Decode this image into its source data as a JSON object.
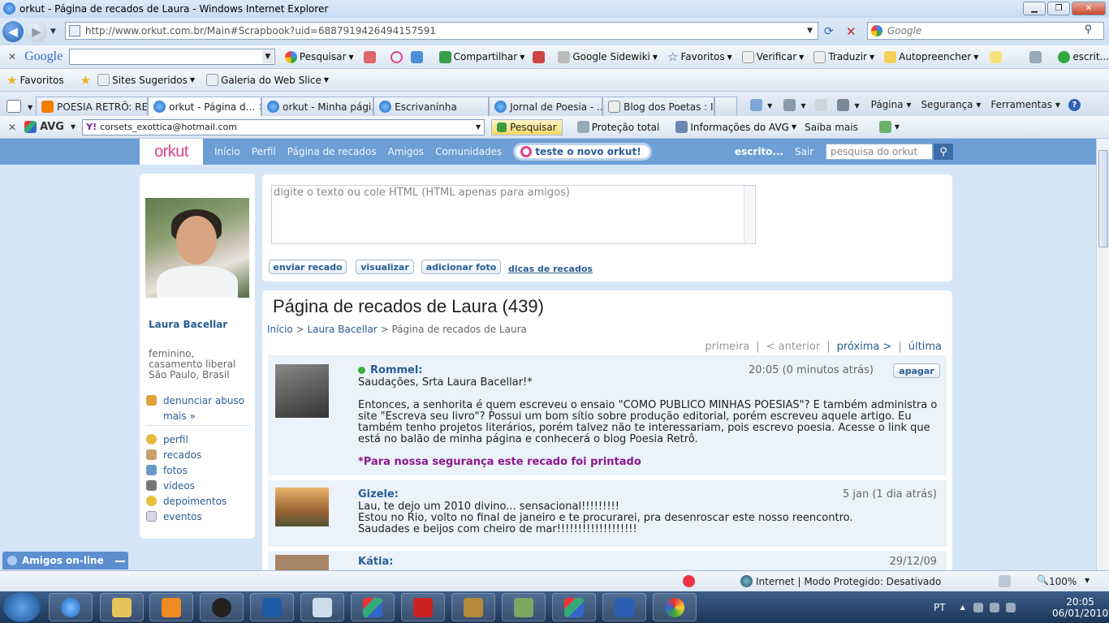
{
  "window": {
    "title": "orkut - Página de recados de Laura - Windows Internet Explorer"
  },
  "address": {
    "url": "http://www.orkut.com.br/Main#Scrapbook?uid=6887919426494157591",
    "search_placeholder": "Google"
  },
  "google_toolbar": {
    "brand": "Google",
    "items": [
      "Pesquisar",
      "Compartilhar",
      "Google Sidewiki",
      "Favoritos",
      "Verificar",
      "Traduzir",
      "Autopreencher",
      "escrit..."
    ]
  },
  "favorites_bar": {
    "favorites": "Favoritos",
    "items": [
      "Sites Sugeridos",
      "Galeria do Web Slice"
    ]
  },
  "tabs": [
    {
      "label": "POESIA RETRÔ: RE...",
      "active": false
    },
    {
      "label": "orkut - Página d...",
      "active": true
    },
    {
      "label": "orkut - Minha pági...",
      "active": false
    },
    {
      "label": "Escrivaninha",
      "active": false
    },
    {
      "label": "Jornal de Poesia - ...",
      "active": false
    },
    {
      "label": "Blog dos Poetas : I...",
      "active": false
    }
  ],
  "command_bar": {
    "pagina": "Página",
    "seguranca": "Segurança",
    "ferramentas": "Ferramentas"
  },
  "avg_toolbar": {
    "brand": "AVG",
    "email": "corsets_exottica@hotmail.com",
    "pesquisar": "Pesquisar",
    "protecao": "Proteção total",
    "info": "Informações do AVG",
    "saiba": "Saiba mais"
  },
  "orkut": {
    "logo": "orkut",
    "nav": [
      "Início",
      "Perfil",
      "Página de recados",
      "Amigos",
      "Comunidades"
    ],
    "try_new": "teste o novo orkut!",
    "user": "escrito...",
    "logout": "Sair",
    "search_placeholder": "pesquisa do orkut"
  },
  "profile": {
    "name": "Laura Bacellar",
    "info": "feminino, casamento liberal",
    "location": "São Paulo, Brasil",
    "actions": [
      "denunciar abuso",
      "mais »"
    ],
    "menu": [
      "perfil",
      "recados",
      "fotos",
      "vídeos",
      "depoimentos",
      "eventos"
    ]
  },
  "friends_online": "Amigos on-line",
  "compose": {
    "placeholder": "digite o texto ou cole HTML (HTML apenas para amigos)",
    "send": "enviar recado",
    "preview": "visualizar",
    "add_photo": "adicionar foto",
    "tips": "dicas de recados"
  },
  "scrapbook": {
    "title": "Página de recados de Laura (439)",
    "breadcrumb": {
      "home": "Início",
      "user": "Laura Bacellar",
      "sep": ">",
      "current": "Página de recados de Laura"
    },
    "pager": {
      "first": "primeira",
      "prev": "< anterior",
      "next": "próxima >",
      "last": "última",
      "sep": "|"
    },
    "delete": "apagar",
    "scraps": [
      {
        "author": "Rommel:",
        "time": "20:05 (0 minutos atrás)",
        "lines": [
          "Saudações, Srta Laura Bacellar!*",
          "",
          "Entonces, a senhorita é quem escreveu o ensaio \"COMO PUBLICO MINHAS POESIAS\"? E também administra o site \"Escreva seu livro\"? Possui um bom sítio sobre produção editorial, porém escreveu aquele artigo. Eu também tenho projetos literários, porém talvez não te interessariam, pois escrevo poesia. Acesse o link que está no balão de minha página e conhecerá o blog Poesia Retrô."
        ],
        "note": "*Para nossa segurança este recado foi printado"
      },
      {
        "author": "Gizele:",
        "time": "5 jan (1 dia atrás)",
        "lines": [
          "Lau, te dejo um 2010 divino... sensacional!!!!!!!!!",
          "Estou no Rio, volto no final de janeiro e te procurarei, pra desenroscar este nosso reencontro.",
          "Saudades e beijos com cheiro de mar!!!!!!!!!!!!!!!!!!!"
        ]
      },
      {
        "author": "Kátia:",
        "time": "29/12/09"
      }
    ]
  },
  "status": {
    "zone": "Internet | Modo Protegido: Desativado",
    "zoom": "100%"
  },
  "taskbar": {
    "lang": "PT",
    "time": "20:05",
    "date": "06/01/2010"
  }
}
